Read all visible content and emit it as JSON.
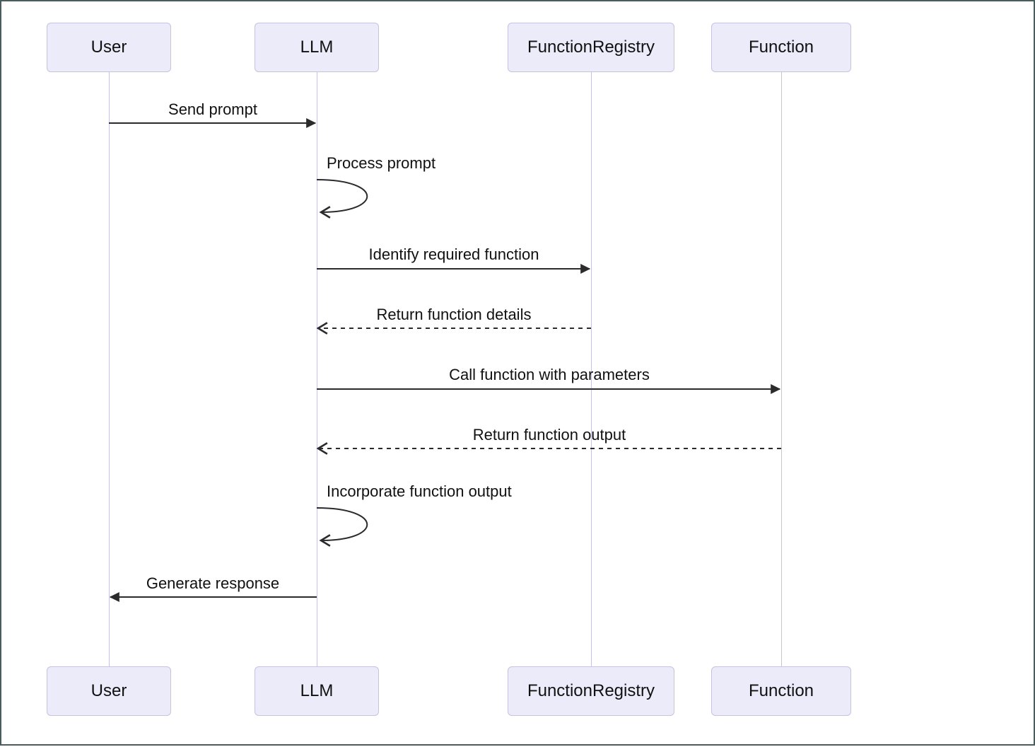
{
  "chart_data": {
    "type": "sequence_diagram",
    "participants": [
      "User",
      "LLM",
      "FunctionRegistry",
      "Function"
    ],
    "messages": [
      {
        "from": "User",
        "to": "LLM",
        "label": "Send prompt",
        "style": "solid"
      },
      {
        "from": "LLM",
        "to": "LLM",
        "label": "Process prompt",
        "style": "self"
      },
      {
        "from": "LLM",
        "to": "FunctionRegistry",
        "label": "Identify required function",
        "style": "solid"
      },
      {
        "from": "FunctionRegistry",
        "to": "LLM",
        "label": "Return function details",
        "style": "dashed"
      },
      {
        "from": "LLM",
        "to": "Function",
        "label": "Call function with parameters",
        "style": "solid"
      },
      {
        "from": "Function",
        "to": "LLM",
        "label": "Return function output",
        "style": "dashed"
      },
      {
        "from": "LLM",
        "to": "LLM",
        "label": "Incorporate function output",
        "style": "self"
      },
      {
        "from": "LLM",
        "to": "User",
        "label": "Generate response",
        "style": "solid"
      }
    ]
  },
  "participants": {
    "p0": {
      "label": "User"
    },
    "p1": {
      "label": "LLM"
    },
    "p2": {
      "label": "FunctionRegistry"
    },
    "p3": {
      "label": "Function"
    }
  },
  "messages": {
    "m0": "Send prompt",
    "m1": "Process prompt",
    "m2": "Identify required function",
    "m3": "Return function details",
    "m4": "Call function with parameters",
    "m5": "Return function output",
    "m6": "Incorporate function output",
    "m7": "Generate response"
  }
}
